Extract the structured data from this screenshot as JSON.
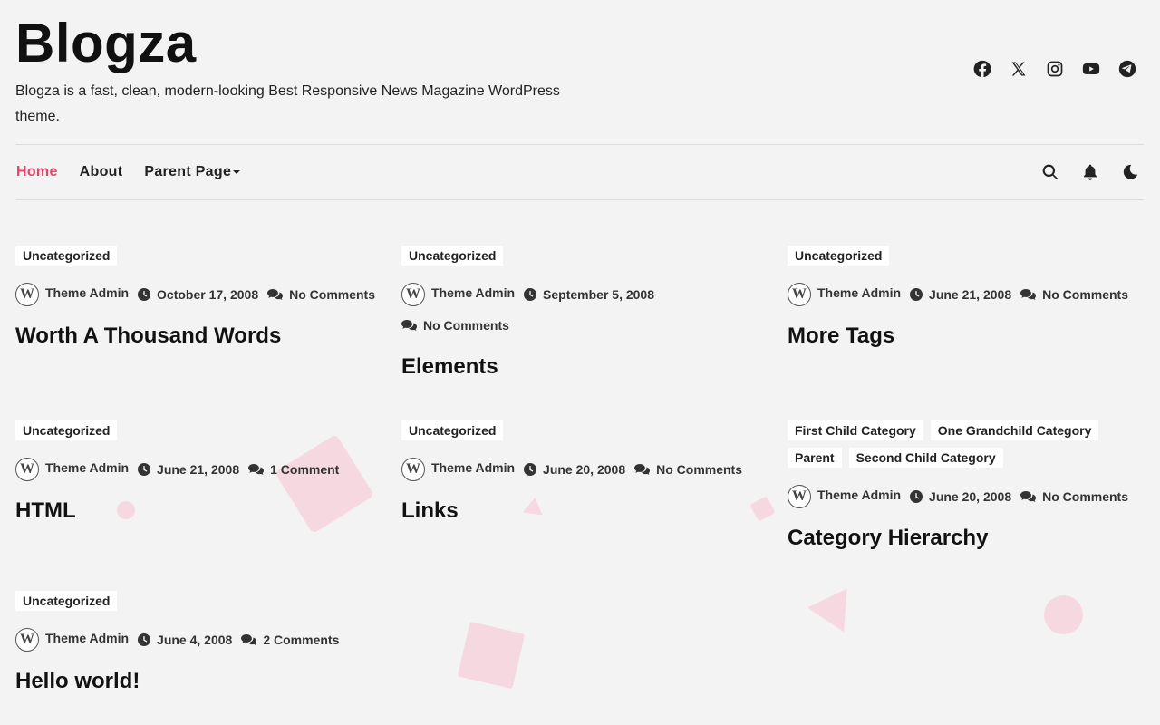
{
  "site": {
    "title": "Blogza",
    "description": "Blogza is a fast, clean, modern-looking Best Responsive News Magazine WordPress theme."
  },
  "social_icons": [
    "facebook-icon",
    "x-twitter-icon",
    "instagram-icon",
    "youtube-icon",
    "telegram-icon"
  ],
  "nav": {
    "items": [
      {
        "label": "Home",
        "active": true
      },
      {
        "label": "About"
      },
      {
        "label": "Parent Page",
        "has_dropdown": true
      }
    ],
    "icons": [
      "search-icon",
      "bell-icon",
      "dark-mode-icon"
    ]
  },
  "posts": [
    {
      "categories": [
        "Uncategorized"
      ],
      "author": "Theme Admin",
      "date": "October 17, 2008",
      "comments": "No Comments",
      "title": "Worth A Thousand Words"
    },
    {
      "categories": [
        "Uncategorized"
      ],
      "author": "Theme Admin",
      "date": "September 5, 2008",
      "comments": "No Comments",
      "title": "Elements"
    },
    {
      "categories": [
        "Uncategorized"
      ],
      "author": "Theme Admin",
      "date": "June 21, 2008",
      "comments": "No Comments",
      "title": "More Tags"
    },
    {
      "categories": [
        "Uncategorized"
      ],
      "author": "Theme Admin",
      "date": "June 21, 2008",
      "comments": "1 Comment",
      "title": "HTML"
    },
    {
      "categories": [
        "Uncategorized"
      ],
      "author": "Theme Admin",
      "date": "June 20, 2008",
      "comments": "No Comments",
      "title": "Links"
    },
    {
      "categories": [
        "First Child Category",
        "One Grandchild Category",
        "Parent",
        "Second Child Category"
      ],
      "author": "Theme Admin",
      "date": "June 20, 2008",
      "comments": "No Comments",
      "title": "Category Hierarchy"
    },
    {
      "categories": [
        "Uncategorized"
      ],
      "author": "Theme Admin",
      "date": "June 4, 2008",
      "comments": "2 Comments",
      "title": "Hello world!"
    }
  ],
  "colors": {
    "accent": "#e0476a",
    "background": "#f3f3f3",
    "decoration": "#f6d9e0"
  }
}
